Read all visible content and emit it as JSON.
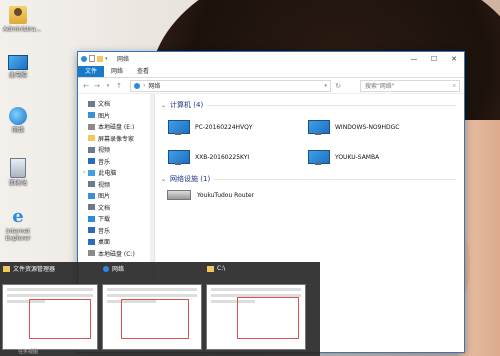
{
  "desktop": {
    "icons": [
      {
        "label": "Administra...",
        "icon": "user-folder-icon"
      },
      {
        "label": "此电脑",
        "icon": "computer-icon"
      },
      {
        "label": "网络",
        "icon": "network-icon"
      },
      {
        "label": "回收站",
        "icon": "recycle-bin-icon"
      },
      {
        "label": "Internet Explorer",
        "icon": "ie-icon"
      }
    ]
  },
  "window": {
    "title": "网络",
    "ribbon_tabs": [
      "文件",
      "网络",
      "查看"
    ],
    "address": "网络",
    "search_placeholder": "搜索\"网络\"",
    "controls": {
      "minimize": "—",
      "maximize": "☐",
      "close": "✕"
    },
    "nav_items": [
      {
        "label": "文档",
        "icon": "document-icon",
        "root": false
      },
      {
        "label": "图片",
        "icon": "picture-icon",
        "root": false
      },
      {
        "label": "本地磁盘 (E:)",
        "icon": "drive-icon",
        "root": false
      },
      {
        "label": "屏幕录像专家",
        "icon": "folder-icon",
        "root": false
      },
      {
        "label": "视频",
        "icon": "video-icon",
        "root": false
      },
      {
        "label": "音乐",
        "icon": "music-icon",
        "root": false
      },
      {
        "label": "此电脑",
        "icon": "computer-icon",
        "root": true
      },
      {
        "label": "视频",
        "icon": "video-icon",
        "root": false
      },
      {
        "label": "图片",
        "icon": "picture-icon",
        "root": false
      },
      {
        "label": "文档",
        "icon": "document-icon",
        "root": false
      },
      {
        "label": "下载",
        "icon": "download-icon",
        "root": false
      },
      {
        "label": "音乐",
        "icon": "music-icon",
        "root": false
      },
      {
        "label": "桌面",
        "icon": "desktop-icon",
        "root": false
      },
      {
        "label": "本地磁盘 (C:)",
        "icon": "drive-icon",
        "root": false
      }
    ],
    "groups": {
      "computers": {
        "header": "计算机 (4)",
        "items": [
          "PC-20160224HVQY",
          "WINDOWS-NO9HDGC",
          "XXB-20160225KYI",
          "YOUKU-SAMBA"
        ]
      },
      "devices": {
        "header": "网络设施 (1)",
        "items": [
          "YoukuTudou Router"
        ]
      }
    }
  },
  "taskview": {
    "thumbnails": [
      {
        "title": "文件资源管理器"
      },
      {
        "title": "网络"
      },
      {
        "title": "C:\\"
      }
    ],
    "label": "任务视图"
  },
  "colors": {
    "accent": "#1979ca",
    "header_text": "#1e3287",
    "highlight": "#d9534f"
  }
}
